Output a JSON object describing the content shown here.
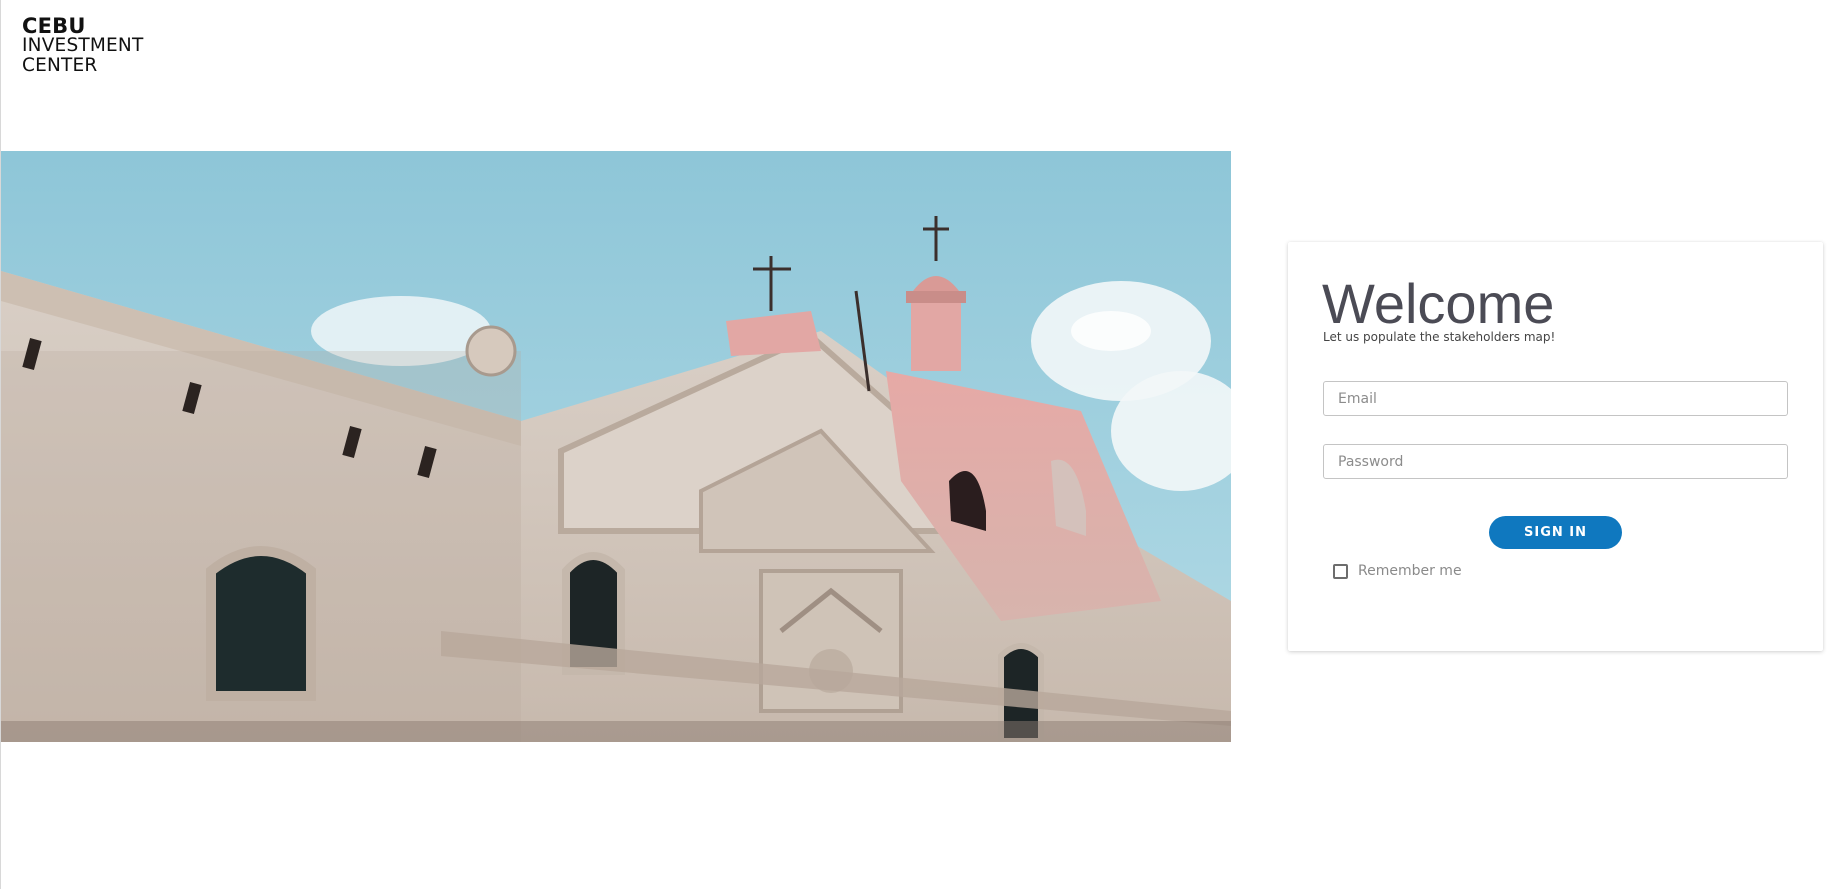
{
  "brand": {
    "line1": "CEBU",
    "line2": "INVESTMENT",
    "line3": "CENTER"
  },
  "hero": {
    "icon": "church-photo",
    "sky_color": "#9ccfdd"
  },
  "login": {
    "title": "Welcome",
    "subtitle": "Let us populate the stakeholders map!",
    "email_placeholder": "Email",
    "email_value": "",
    "password_placeholder": "Password",
    "password_value": "",
    "sign_in_label": "SIGN IN",
    "remember_label": "Remember me",
    "remember_checked": false,
    "accent_color": "#0f78bf"
  }
}
